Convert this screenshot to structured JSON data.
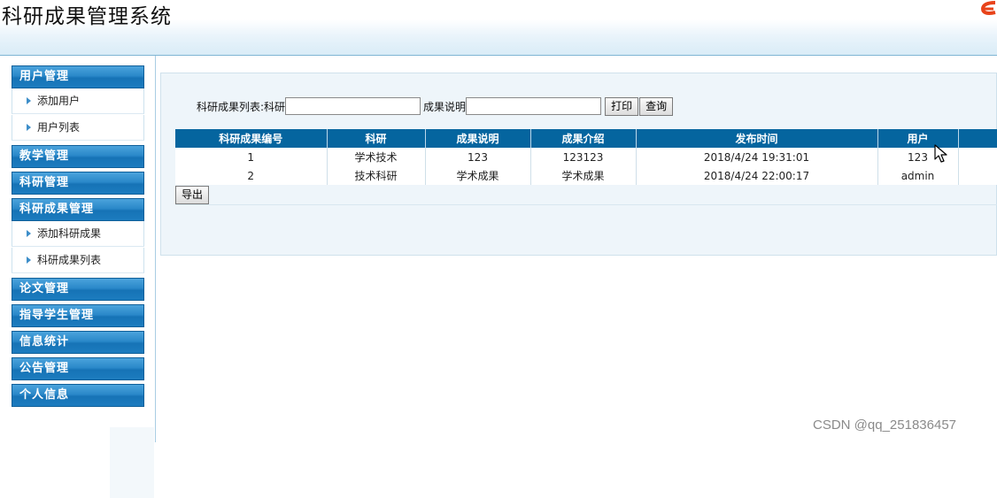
{
  "app": {
    "title": "科研成果管理系统"
  },
  "sidebar": {
    "sections": [
      {
        "label": "用户管理",
        "items": [
          "添加用户",
          "用户列表"
        ]
      },
      {
        "label": "教学管理",
        "items": []
      },
      {
        "label": "科研管理",
        "items": []
      },
      {
        "label": "科研成果管理",
        "items": [
          "添加科研成果",
          "科研成果列表"
        ]
      },
      {
        "label": "论文管理",
        "items": []
      },
      {
        "label": "指导学生管理",
        "items": []
      },
      {
        "label": "信息统计",
        "items": []
      },
      {
        "label": "公告管理",
        "items": []
      },
      {
        "label": "个人信息",
        "items": []
      }
    ]
  },
  "search": {
    "label_keyan": "科研成果列表:科研",
    "keyan_value": "",
    "label_shuoming": "成果说明",
    "shuoming_value": "",
    "print_label": "打印",
    "query_label": "查询"
  },
  "table": {
    "headers": [
      "科研成果编号",
      "科研",
      "成果说明",
      "成果介绍",
      "发布时间",
      "用户"
    ],
    "rows": [
      [
        "1",
        "学术技术",
        "123",
        "123123",
        "2018/4/24 19:31:01",
        "123"
      ],
      [
        "2",
        "技术科研",
        "学术成果",
        "学术成果",
        "2018/4/24 22:00:17",
        "admin"
      ]
    ]
  },
  "export_label": "导出",
  "watermark": "CSDN @qq_251836457",
  "colors": {
    "header_blue": "#05659f",
    "menu_blue": "#1c7cbf",
    "accent": "#e8431a"
  },
  "icons": {
    "corner_logo": "brand-logo-icon",
    "cursor": "mouse-pointer-icon"
  }
}
